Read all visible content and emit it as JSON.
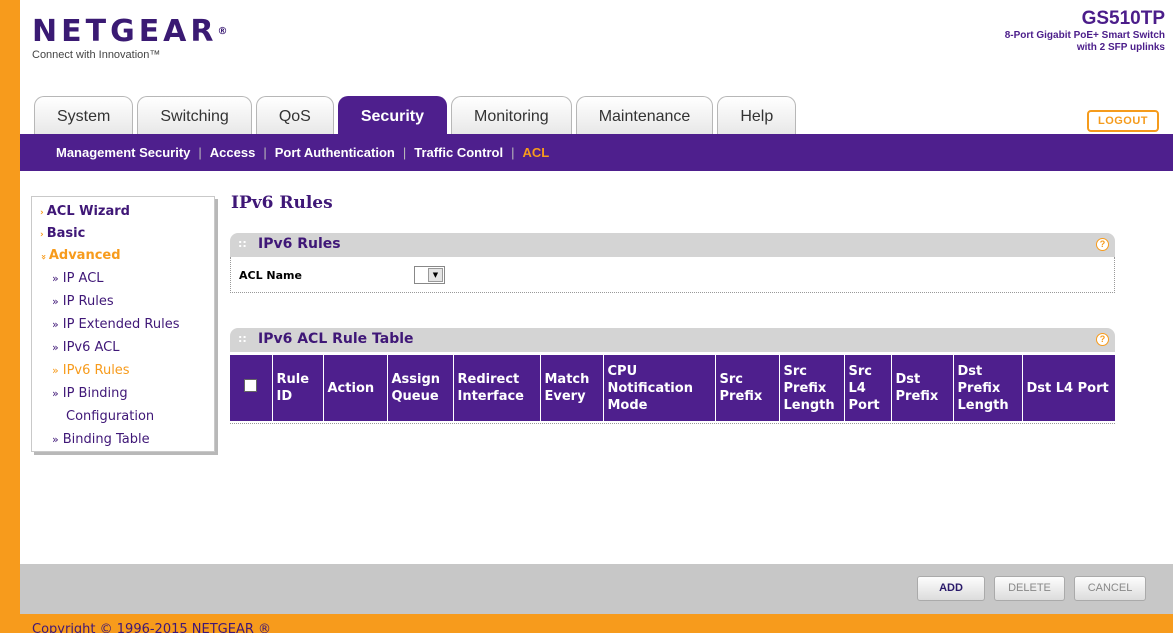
{
  "brand": {
    "logo": "NETGEAR",
    "logo_mark": "®",
    "tagline": "Connect with Innovation™"
  },
  "product": {
    "name": "GS510TP",
    "desc_line1": "8-Port Gigabit PoE+ Smart Switch",
    "desc_line2": "with 2 SFP uplinks"
  },
  "tabs": [
    {
      "label": "System"
    },
    {
      "label": "Switching"
    },
    {
      "label": "QoS"
    },
    {
      "label": "Security",
      "active": true
    },
    {
      "label": "Monitoring"
    },
    {
      "label": "Maintenance"
    },
    {
      "label": "Help"
    }
  ],
  "logout_label": "LOGOUT",
  "subnav": [
    {
      "label": "Management Security"
    },
    {
      "label": "Access"
    },
    {
      "label": "Port Authentication"
    },
    {
      "label": "Traffic Control"
    },
    {
      "label": "ACL",
      "active": true
    }
  ],
  "sidebar": {
    "items": [
      {
        "label": "ACL Wizard",
        "arrow": "›"
      },
      {
        "label": "Basic",
        "arrow": "›"
      },
      {
        "label": "Advanced",
        "arrow": "»"
      },
      {
        "label": "IP ACL"
      },
      {
        "label": "IP Rules"
      },
      {
        "label": "IP Extended Rules"
      },
      {
        "label": "IPv6 ACL"
      },
      {
        "label": "IPv6 Rules",
        "active": true
      },
      {
        "label": "IP Binding"
      },
      {
        "label": "Configuration"
      },
      {
        "label": "Binding Table"
      }
    ],
    "sub_bullet": "»"
  },
  "page_title": "IPv6 Rules",
  "panel1": {
    "title": "IPv6 Rules",
    "acl_name_label": "ACL Name",
    "acl_name_value": ""
  },
  "panel2": {
    "title": "IPv6 ACL Rule Table",
    "columns": [
      "Rule ID",
      "Action",
      "Assign Queue",
      "Redirect Interface",
      "Match Every",
      "CPU Notification Mode",
      "Src Prefix",
      "Src Prefix Length",
      "Src L4 Port",
      "Dst Prefix",
      "Dst Prefix Length",
      "Dst L4 Port"
    ]
  },
  "help_glyph": "?",
  "select_arrow": "▼",
  "buttons": {
    "add": "ADD",
    "delete": "DELETE",
    "cancel": "CANCEL"
  },
  "footer": {
    "copyright": "Copyright © 1996-2015 NETGEAR ®"
  },
  "colors": {
    "brand_purple": "#4e1f8d",
    "accent_orange": "#f79b1c"
  }
}
